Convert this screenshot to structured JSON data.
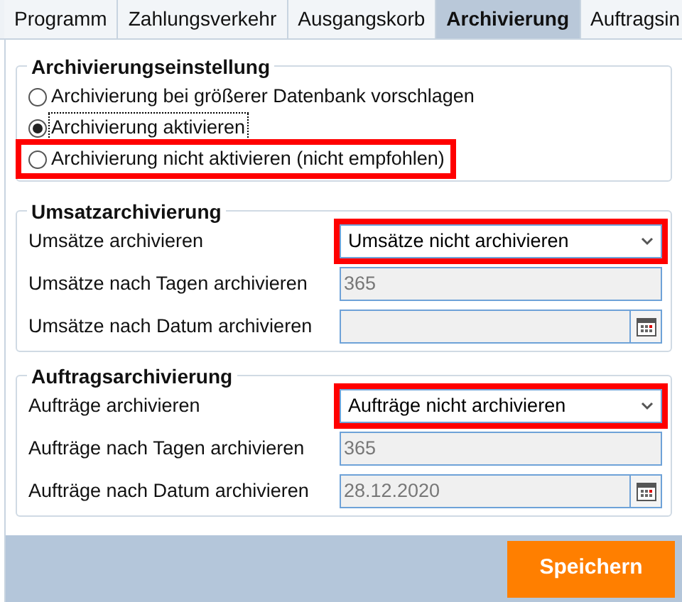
{
  "tabs": [
    {
      "label": "Programm",
      "selected": false
    },
    {
      "label": "Zahlungsverkehr",
      "selected": false
    },
    {
      "label": "Ausgangskorb",
      "selected": false
    },
    {
      "label": "Archivierung",
      "selected": true
    },
    {
      "label": "Auftragsin",
      "selected": false
    }
  ],
  "settings": {
    "title": "Archivierungseinstellung",
    "options": [
      {
        "label": "Archivierung bei größerer Datenbank vorschlagen",
        "selected": false,
        "focused": false,
        "highlighted": false
      },
      {
        "label": "Archivierung aktivieren",
        "selected": true,
        "focused": true,
        "highlighted": false
      },
      {
        "label": "Archivierung nicht aktivieren (nicht empfohlen)",
        "selected": false,
        "focused": false,
        "highlighted": true
      }
    ]
  },
  "sections": [
    {
      "title": "Umsatzarchivierung",
      "fields": [
        {
          "kind": "select",
          "label": "Umsätze archivieren",
          "value": "Umsätze nicht archivieren",
          "disabled": false,
          "highlighted": true
        },
        {
          "kind": "text",
          "label": "Umsätze nach Tagen archivieren",
          "value": "365",
          "disabled": true,
          "highlighted": false
        },
        {
          "kind": "date",
          "label": "Umsätze nach Datum archivieren",
          "disabled": true,
          "highlighted": false
        }
      ]
    },
    {
      "title": "Auftragsarchivierung",
      "fields": [
        {
          "kind": "select",
          "label": "Aufträge archivieren",
          "value": "Aufträge nicht archivieren",
          "disabled": false,
          "highlighted": true
        },
        {
          "kind": "text",
          "label": "Aufträge nach Tagen archivieren",
          "value": "365",
          "disabled": true,
          "highlighted": false
        },
        {
          "kind": "date",
          "label": "Aufträge nach Datum archivieren",
          "value": "28.12.2020",
          "disabled": true,
          "highlighted": false
        }
      ]
    }
  ],
  "save_button": "Speichern"
}
